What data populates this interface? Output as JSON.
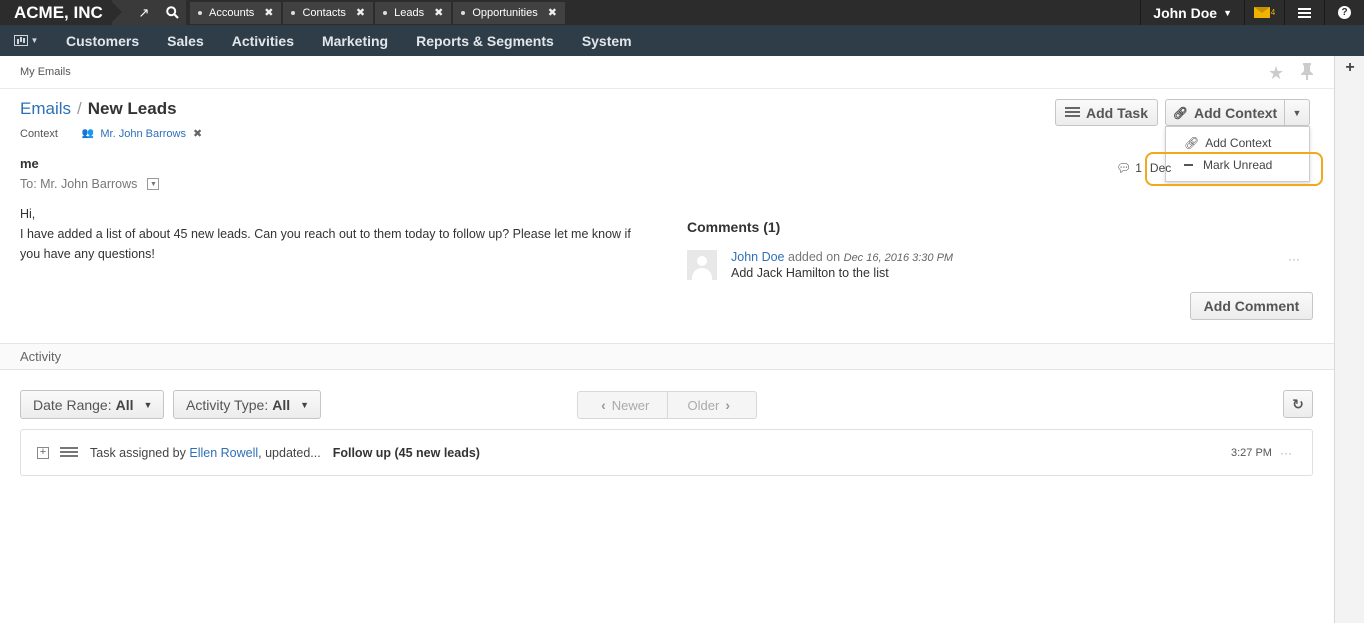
{
  "topbar": {
    "logo": "ACME, INC",
    "tabs": [
      {
        "label": "Accounts"
      },
      {
        "label": "Contacts"
      },
      {
        "label": "Leads"
      },
      {
        "label": "Opportunities"
      }
    ],
    "user": "John Doe",
    "mail_badge": "4"
  },
  "nav": {
    "items": [
      "Customers",
      "Sales",
      "Activities",
      "Marketing",
      "Reports & Segments",
      "System"
    ]
  },
  "breadcrumb": "My Emails",
  "title": {
    "parent": "Emails",
    "current": "New Leads"
  },
  "context": {
    "label": "Context",
    "value": "Mr. John Barrows"
  },
  "actions": {
    "add_task": "Add Task",
    "add_context": "Add Context",
    "dropdown": [
      "Add Context",
      "Mark Unread"
    ]
  },
  "email": {
    "from": "me",
    "to": "To: Mr. John Barrows",
    "comment_count": "1",
    "date_prefix": "Dec",
    "body_line1": "Hi,",
    "body_line2": "I have added a list of about 45 new leads. Can you reach out to them today to follow up? Please let me know if you have any questions!"
  },
  "comments": {
    "title": "Comments (1)",
    "items": [
      {
        "author": "John Doe",
        "action": "added on",
        "date": "Dec 16, 2016 3:30 PM",
        "text": "Add Jack Hamilton to the list"
      }
    ],
    "more": "···",
    "add_button": "Add Comment"
  },
  "activity": {
    "title": "Activity",
    "date_range_label": "Date Range:",
    "date_range_value": "All",
    "type_label": "Activity Type:",
    "type_value": "All",
    "newer": "Newer",
    "older": "Older",
    "rows": [
      {
        "prefix": "Task assigned by",
        "who": "Ellen Rowell",
        "suffix": ", updated...",
        "subject": "Follow up (45 new leads)",
        "time": "3:27 PM",
        "more": "···"
      }
    ]
  }
}
